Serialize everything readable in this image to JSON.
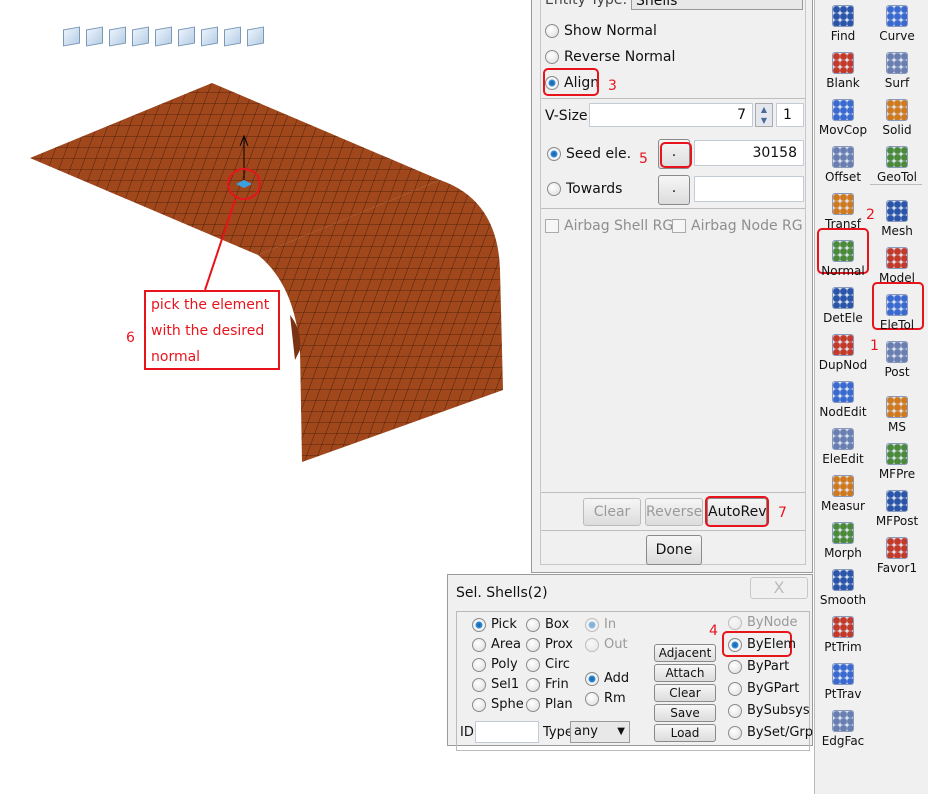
{
  "view_icons": [
    "iso",
    "front",
    "back",
    "left",
    "right",
    "top",
    "bottom",
    "iso2",
    "iso3"
  ],
  "annotation": {
    "text_lines": [
      "pick the element",
      "with the desired",
      "normal"
    ],
    "step": "6"
  },
  "normal_panel": {
    "entity_type_label": "Entity Type:",
    "entity_type_value": "Shells",
    "options": [
      "Show Normal",
      "Reverse Normal",
      "Align"
    ],
    "selected": "Align",
    "vsize_label": "V-Size",
    "vsize_value": "7",
    "vsize_step": "1",
    "seed_label": "Seed ele.",
    "seed_value": "30158",
    "pick_btn": ".",
    "towards_label": "Towards",
    "towards_value": "",
    "airbag_shell": "Airbag Shell RG",
    "airbag_node": "Airbag Node RG",
    "clear": "Clear",
    "reverse": "Reverse",
    "autorev": "AutoRev",
    "done": "Done",
    "steps": {
      "align": "3",
      "seed": "5",
      "autorev": "7"
    }
  },
  "selection": {
    "title": "Sel. Shells(2)",
    "close": "X",
    "col1": [
      "Pick",
      "Area",
      "Poly",
      "Sel1",
      "Sphe"
    ],
    "col2": [
      "Box",
      "Prox",
      "Circ",
      "Frin",
      "Plan"
    ],
    "col3": [
      "In",
      "Out",
      "Add",
      "Rm"
    ],
    "buttons": [
      "Adjacent",
      "Attach",
      "Clear",
      "Save",
      "Load"
    ],
    "by": [
      "ByNode",
      "ByElem",
      "ByPart",
      "ByGPart",
      "BySubsys",
      "BySet/Grp"
    ],
    "id_label": "ID",
    "id_value": "",
    "type_label": "Type",
    "type_value": "any",
    "step": "4"
  },
  "toolbar": {
    "left": [
      "Find",
      "Blank",
      "MovCop",
      "Offset",
      "Transf",
      "Normal",
      "DetEle",
      "DupNod",
      "NodEdit",
      "EleEdit",
      "Measur",
      "Morph",
      "Smooth",
      "PtTrim",
      "PtTrav",
      "EdgFac"
    ],
    "right": [
      "Curve",
      "Surf",
      "Solid",
      "GeoTol",
      "Mesh",
      "Model",
      "EleTol",
      "Post",
      "MS",
      "MFPre",
      "MFPost",
      "Favor1"
    ],
    "steps": {
      "normal": "2",
      "eletol": "1"
    }
  },
  "colors": {
    "mesh": "#a0471c",
    "annotation": "#e8141c",
    "accent": "#2e8ad8"
  }
}
